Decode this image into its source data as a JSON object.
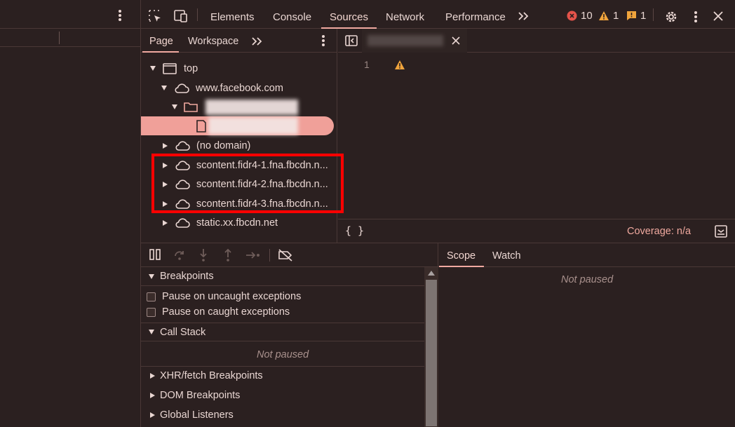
{
  "main_tabs": [
    "Elements",
    "Console",
    "Sources",
    "Network",
    "Performance"
  ],
  "active_tab": "Sources",
  "counters": {
    "errors": "10",
    "warnings": "1",
    "issues": "1"
  },
  "navigator": {
    "tabs": [
      "Page",
      "Workspace"
    ],
    "active_tab": "Page",
    "tree": {
      "top": "top",
      "domain_facebook": "www.facebook.com",
      "no_domain": "(no domain)",
      "scontent1": "scontent.fidr4-1.fna.fbcdn.n...",
      "scontent2": "scontent.fidr4-2.fna.fbcdn.n...",
      "scontent3": "scontent.fidr4-3.fna.fbcdn.n...",
      "static": "static.xx.fbcdn.net"
    }
  },
  "editor": {
    "line_number": "1",
    "coverage": "Coverage: n/a",
    "format_label": "{ }"
  },
  "debugger": {
    "breakpoints_title": "Breakpoints",
    "pause_uncaught": "Pause on uncaught exceptions",
    "pause_caught": "Pause on caught exceptions",
    "call_stack_title": "Call Stack",
    "call_stack_status": "Not paused",
    "xhr_title": "XHR/fetch Breakpoints",
    "dom_title": "DOM Breakpoints",
    "global_title": "Global Listeners"
  },
  "scope": {
    "tabs": [
      "Scope",
      "Watch"
    ],
    "active_tab": "Scope",
    "status": "Not paused"
  },
  "colors": {
    "background": "#2b2020",
    "accent": "#f0a9a0",
    "selected_row": "#f0a099",
    "error": "#e4534a",
    "warning": "#f0a43c",
    "highlight_box": "#ff0000"
  }
}
